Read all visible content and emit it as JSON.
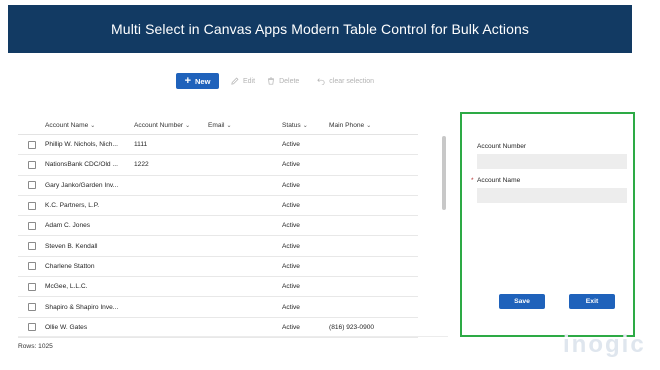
{
  "banner": {
    "title": "Multi Select in Canvas Apps Modern Table Control for Bulk Actions"
  },
  "toolbar": {
    "new_label": "New",
    "edit_label": "Edit",
    "delete_label": "Delete",
    "clear_label": "clear selection"
  },
  "grid": {
    "columns": [
      {
        "label": "Account Name"
      },
      {
        "label": "Account Number"
      },
      {
        "label": "Email"
      },
      {
        "label": "Status"
      },
      {
        "label": "Main Phone"
      }
    ],
    "rows": [
      {
        "name": "Phillip W. Nichols, Nich...",
        "number": "1111",
        "email": "",
        "status": "Active",
        "phone": ""
      },
      {
        "name": "NationsBank CDC/Old ...",
        "number": "1222",
        "email": "",
        "status": "Active",
        "phone": ""
      },
      {
        "name": "Gary Janko/Garden Inv...",
        "number": "",
        "email": "",
        "status": "Active",
        "phone": ""
      },
      {
        "name": "K.C. Partners, L.P.",
        "number": "",
        "email": "",
        "status": "Active",
        "phone": ""
      },
      {
        "name": "Adam C. Jones",
        "number": "",
        "email": "",
        "status": "Active",
        "phone": ""
      },
      {
        "name": "Steven B. Kendall",
        "number": "",
        "email": "",
        "status": "Active",
        "phone": ""
      },
      {
        "name": "Charlene Statton",
        "number": "",
        "email": "",
        "status": "Active",
        "phone": ""
      },
      {
        "name": "McGee, L.L.C.",
        "number": "",
        "email": "",
        "status": "Active",
        "phone": ""
      },
      {
        "name": "Shapiro & Shapiro Inve...",
        "number": "",
        "email": "",
        "status": "Active",
        "phone": ""
      },
      {
        "name": "Ollie W. Gates",
        "number": "",
        "email": "",
        "status": "Active",
        "phone": "(816) 923-0900"
      }
    ],
    "rows_count": "Rows: 1025"
  },
  "panel": {
    "account_number_label": "Account Number",
    "account_number_value": "",
    "required_marker": "*",
    "account_name_label": "Account Name",
    "account_name_value": "",
    "save_label": "Save",
    "exit_label": "Exit",
    "border_color": "#2daa45"
  },
  "watermark": "inogic",
  "colors": {
    "banner": "#123a63",
    "primary_button": "#1f62bb"
  }
}
